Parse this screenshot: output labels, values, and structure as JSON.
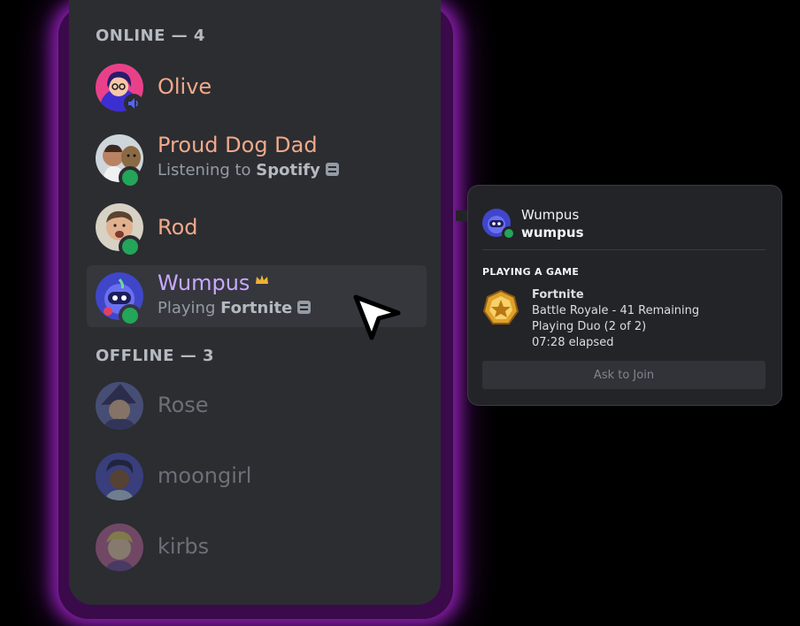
{
  "sections": {
    "online_header": "ONLINE — 4",
    "offline_header": "OFFLINE — 3"
  },
  "members": {
    "olive": {
      "name": "Olive"
    },
    "proud_dog_dad": {
      "name": "Proud Dog Dad",
      "activity_prefix": "Listening to ",
      "activity_name": "Spotify"
    },
    "rod": {
      "name": "Rod"
    },
    "wumpus": {
      "name": "Wumpus",
      "activity_prefix": "Playing ",
      "activity_name": "Fortnite"
    },
    "rose": {
      "name": "Rose"
    },
    "moongirl": {
      "name": "moongirl"
    },
    "kirbs": {
      "name": "kirbs"
    }
  },
  "popout": {
    "display_name": "Wumpus",
    "username": "wumpus",
    "section_title": "PLAYING A GAME",
    "game": {
      "title": "Fortnite",
      "details": "Battle Royale - 41 Remaining",
      "state": "Playing Duo (2 of 2)",
      "elapsed": "07:28 elapsed"
    },
    "join_label": "Ask to Join"
  },
  "colors": {
    "online_status": "#23a55a",
    "name_default": "#f3a88a",
    "name_owner": "#c9a8ff",
    "name_offline": "#6d6f78",
    "panel_bg": "#2b2d31",
    "glow": "#8e1fb0"
  },
  "icons": [
    "speaker-icon",
    "document-icon",
    "crown-icon",
    "cursor-icon",
    "fortnite-badge-icon"
  ]
}
